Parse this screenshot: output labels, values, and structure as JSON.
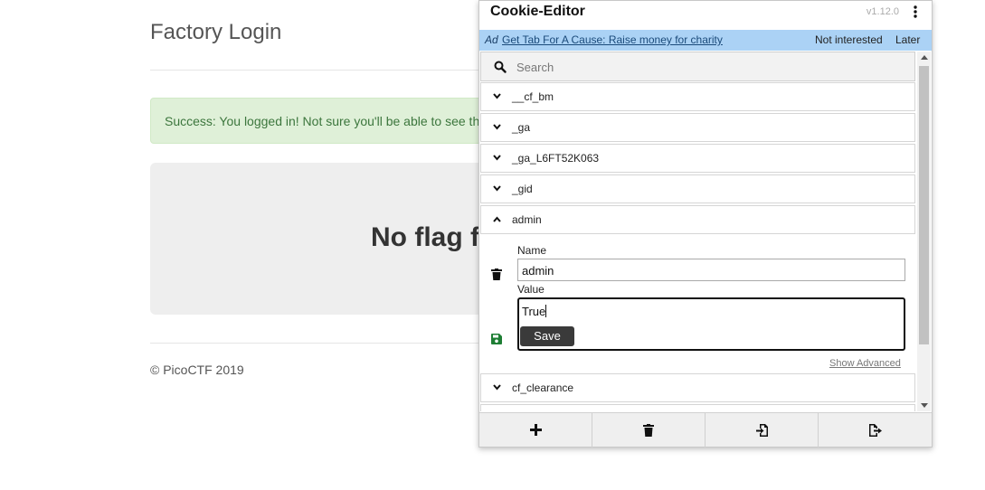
{
  "page": {
    "title": "Factory Login",
    "alert_text": "Success: You logged in! Not sure you'll be able to see th",
    "jumbotron_text": "No flag f",
    "footer": "© PicoCTF 2019"
  },
  "popup": {
    "title": "Cookie-Editor",
    "version": "v1.12.0",
    "menu_icon": "kebab-menu-icon",
    "ad": {
      "label": "Ad",
      "link": "Get Tab For A Cause: Raise money for charity",
      "not_interested": "Not interested",
      "later": "Later",
      "bg_color": "#abd2f5"
    },
    "search": {
      "placeholder": "Search",
      "icon": "search-icon"
    },
    "cookies": [
      {
        "name": "__cf_bm",
        "expanded": false
      },
      {
        "name": "_ga",
        "expanded": false
      },
      {
        "name": "_ga_L6FT52K063",
        "expanded": false
      },
      {
        "name": "_gid",
        "expanded": false
      },
      {
        "name": "admin",
        "expanded": true
      },
      {
        "name": "cf_clearance",
        "expanded": false
      }
    ],
    "editor": {
      "name_label": "Name",
      "name_value": "admin",
      "value_label": "Value",
      "value_value": "True",
      "save_label": "Save",
      "show_advanced": "Show Advanced",
      "save_icon_color": "#1e7e34"
    },
    "toolbar": {
      "buttons": [
        {
          "icon": "plus-icon",
          "action": "add"
        },
        {
          "icon": "trash-icon",
          "action": "delete-all"
        },
        {
          "icon": "import-icon",
          "action": "import"
        },
        {
          "icon": "export-icon",
          "action": "export"
        }
      ]
    }
  }
}
